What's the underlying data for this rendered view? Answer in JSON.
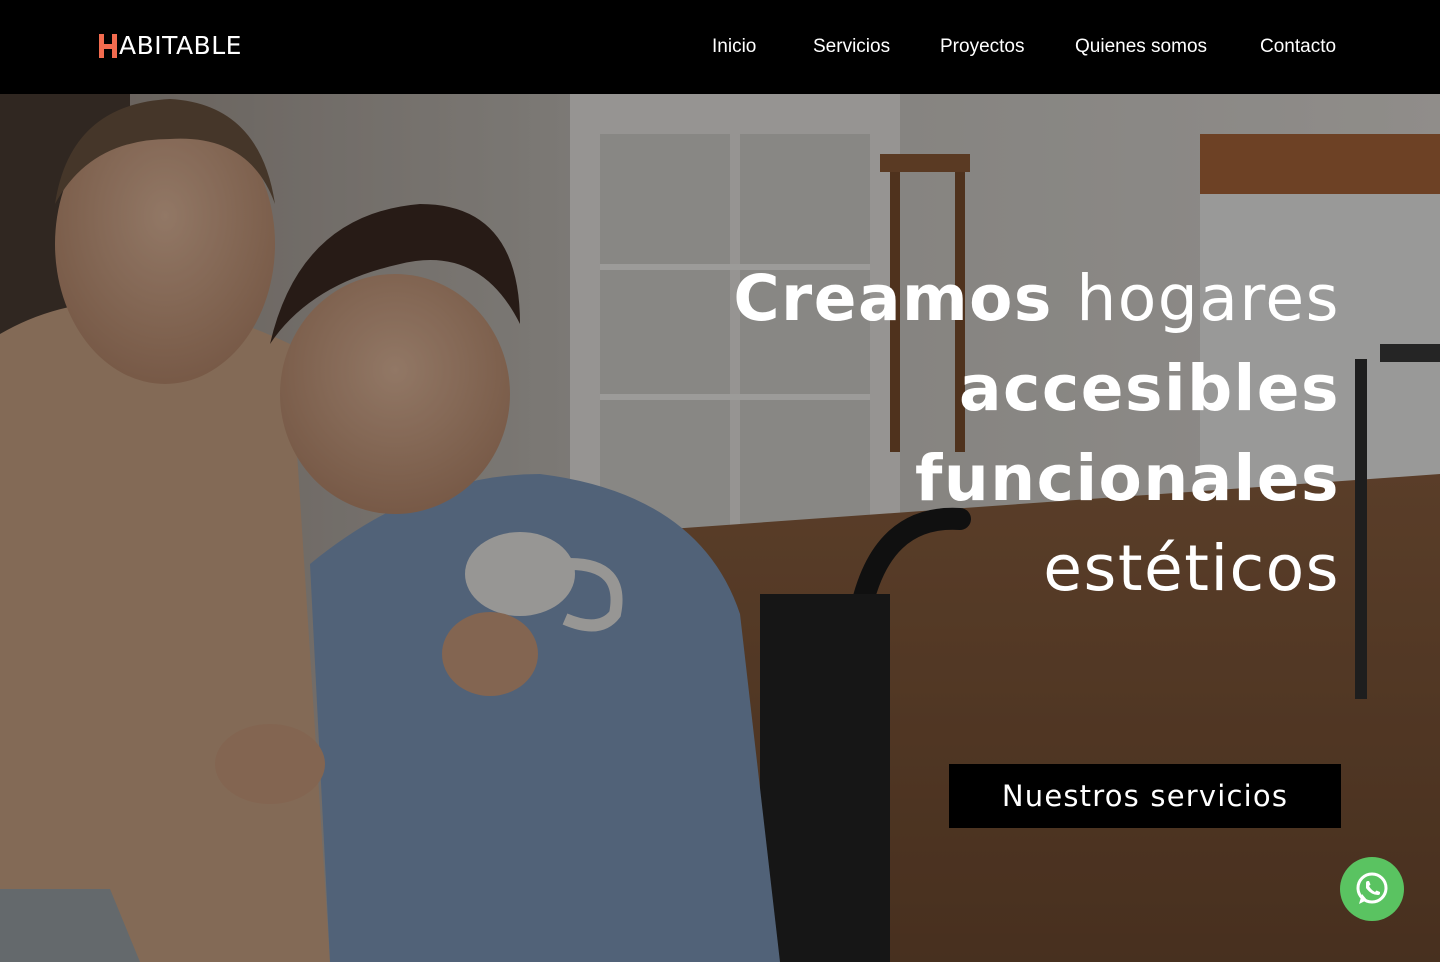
{
  "brand": {
    "name": "ABITABLE",
    "accent_color": "#f26b4f"
  },
  "nav": {
    "items": [
      {
        "label": "Inicio"
      },
      {
        "label": "Servicios"
      },
      {
        "label": "Proyectos"
      },
      {
        "label": "Quienes somos"
      },
      {
        "label": "Contacto"
      }
    ]
  },
  "hero": {
    "headline": {
      "line1_bold": "Creamos",
      "line1_light": "hogares",
      "line2": "accesibles",
      "line3": "funcionales",
      "line4": "estéticos"
    },
    "cta_label": "Nuestros servicios"
  },
  "whatsapp": {
    "icon": "whatsapp-icon",
    "color": "#5ac361"
  }
}
